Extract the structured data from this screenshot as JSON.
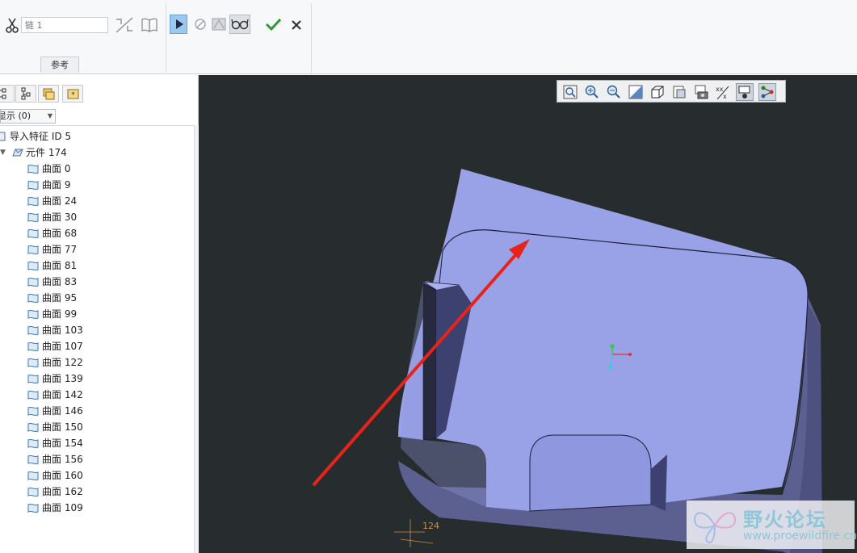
{
  "ribbon": {
    "chain_placeholder": "链 1",
    "references_tab": "参考",
    "buttons": {
      "trim": "scissors-icon",
      "flip": "flip-direction-icon",
      "surface_ref": "open-book-icon",
      "play": "play-icon",
      "pause": "pause-icon",
      "verify": "verify-mode-icon",
      "preview": "glasses-icon",
      "ok": "checkmark-icon",
      "cancel": "cross-icon"
    },
    "colors": {
      "ok": "#2e9a2e",
      "play_active": "#9cc7ef"
    }
  },
  "model_tree": {
    "tabs": [
      "model-tree-icon",
      "layer-tree-icon",
      "folder-browser-icon",
      "favorites-icon"
    ],
    "filter_label": "显示 (0)",
    "root": {
      "label": "导入特征 ID 5"
    },
    "part": {
      "label": "元件 174",
      "expanded": true
    },
    "surfaces": [
      "曲面 0",
      "曲面 9",
      "曲面 24",
      "曲面 30",
      "曲面 68",
      "曲面 77",
      "曲面 81",
      "曲面 83",
      "曲面 95",
      "曲面 99",
      "曲面 103",
      "曲面 107",
      "曲面 122",
      "曲面 139",
      "曲面 142",
      "曲面 146",
      "曲面 150",
      "曲面 154",
      "曲面 156",
      "曲面 160",
      "曲面 162",
      "曲面 109"
    ]
  },
  "viewport": {
    "background": "#272c2e",
    "model_color": "#99a2e6",
    "side_color": "#5c6090",
    "arrow_color": "#e8231a",
    "triad_label": "124",
    "view_toolbar": [
      "refit-icon",
      "zoom-in-icon",
      "zoom-out-icon",
      "repaint-icon",
      "display-style-icon",
      "saved-views-icon",
      "view-manager-icon",
      "datum-display-icon",
      "annotation-display-icon",
      "spin-center-icon"
    ]
  },
  "watermark": {
    "title": "野火论坛",
    "url": "www.proewildfire.cn"
  }
}
